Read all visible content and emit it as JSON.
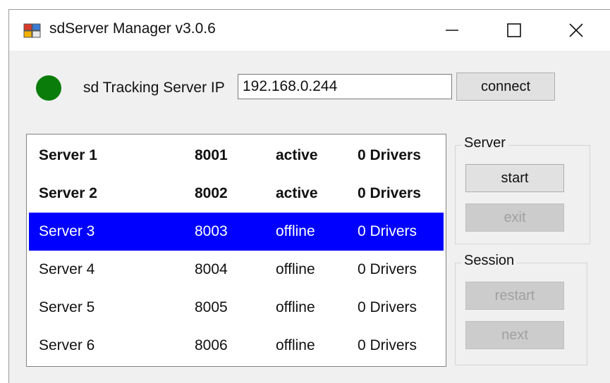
{
  "window": {
    "title": "sdServer Manager v3.0.6",
    "controls": {
      "minimize": "—",
      "maximize": "☐",
      "close": "✕"
    }
  },
  "connection": {
    "status_color": "#0a7c0a",
    "ip_label": "sd Tracking Server IP",
    "ip_value": "192.168.0.244",
    "connect_label": "connect"
  },
  "servers": [
    {
      "name": "Server 1",
      "port": "8001",
      "status": "active",
      "drivers": "0 Drivers"
    },
    {
      "name": "Server 2",
      "port": "8002",
      "status": "active",
      "drivers": "0 Drivers"
    },
    {
      "name": "Server 3",
      "port": "8003",
      "status": "offline",
      "drivers": "0 Drivers"
    },
    {
      "name": "Server 4",
      "port": "8004",
      "status": "offline",
      "drivers": "0 Drivers"
    },
    {
      "name": "Server 5",
      "port": "8005",
      "status": "offline",
      "drivers": "0 Drivers"
    },
    {
      "name": "Server 6",
      "port": "8006",
      "status": "offline",
      "drivers": "0 Drivers"
    }
  ],
  "selected_index": 2,
  "selection_color": "#0000ff",
  "server_group": {
    "legend": "Server",
    "start_label": "start",
    "exit_label": "exit"
  },
  "session_group": {
    "legend": "Session",
    "restart_label": "restart",
    "next_label": "next"
  }
}
